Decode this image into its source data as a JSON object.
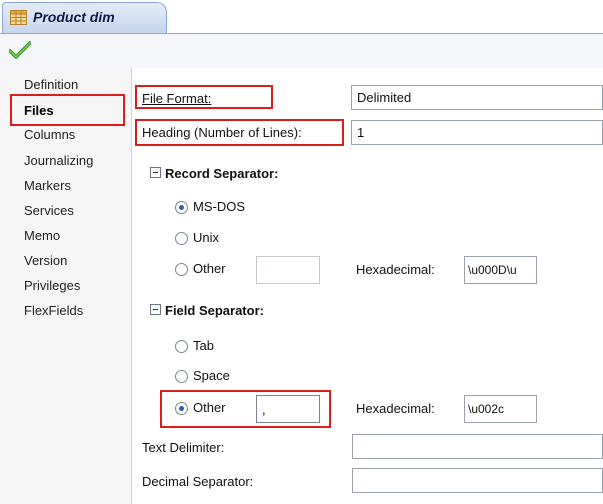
{
  "tab": {
    "title": "Product dim"
  },
  "nav": {
    "items": [
      {
        "label": "Definition"
      },
      {
        "label": "Files"
      },
      {
        "label": "Columns"
      },
      {
        "label": "Journalizing"
      },
      {
        "label": "Markers"
      },
      {
        "label": "Services"
      },
      {
        "label": "Memo"
      },
      {
        "label": "Version"
      },
      {
        "label": "Privileges"
      },
      {
        "label": "FlexFields"
      }
    ],
    "active": "Files"
  },
  "form": {
    "file_format": {
      "label": "File Format:",
      "value": "Delimited"
    },
    "heading": {
      "label": "Heading (Number of Lines):",
      "value": "1"
    },
    "record_separator": {
      "title": "Record Separator:",
      "options": [
        "MS-DOS",
        "Unix",
        "Other"
      ],
      "selected": "MS-DOS",
      "other_value": "",
      "hex_label": "Hexadecimal:",
      "hex_value": "\\u000D\\u"
    },
    "field_separator": {
      "title": "Field Separator:",
      "options": [
        "Tab",
        "Space",
        "Other"
      ],
      "selected": "Other",
      "other_value": ",",
      "hex_label": "Hexadecimal:",
      "hex_value": "\\u002c"
    },
    "text_delimiter": {
      "label": "Text Delimiter:",
      "value": ""
    },
    "decimal_separator": {
      "label": "Decimal Separator:",
      "value": ""
    }
  },
  "colors": {
    "highlight": "#dd1c1c",
    "tab_bg": "#c6d6ee",
    "radio_dot": "#2b5fb4"
  }
}
